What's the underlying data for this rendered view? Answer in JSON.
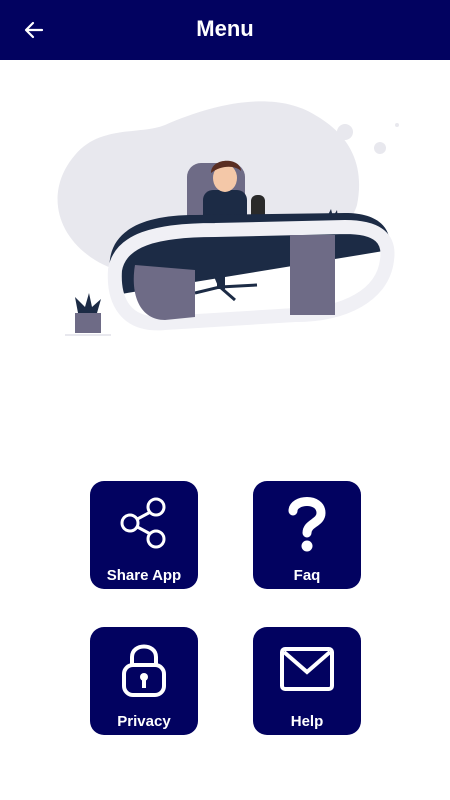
{
  "header": {
    "title": "Menu",
    "back_icon": "arrow-left-icon"
  },
  "colors": {
    "primary": "#020260",
    "text_on_primary": "#ffffff",
    "illustration_blob": "#e8e8ee",
    "desk_dark": "#1c2b45",
    "desk_gray": "#6e6b86"
  },
  "menu": {
    "items": [
      {
        "label": "Share App",
        "icon": "share-icon"
      },
      {
        "label": "Faq",
        "icon": "question-mark-icon"
      },
      {
        "label": "Privacy",
        "icon": "lock-icon"
      },
      {
        "label": "Help",
        "icon": "mail-icon"
      }
    ]
  }
}
